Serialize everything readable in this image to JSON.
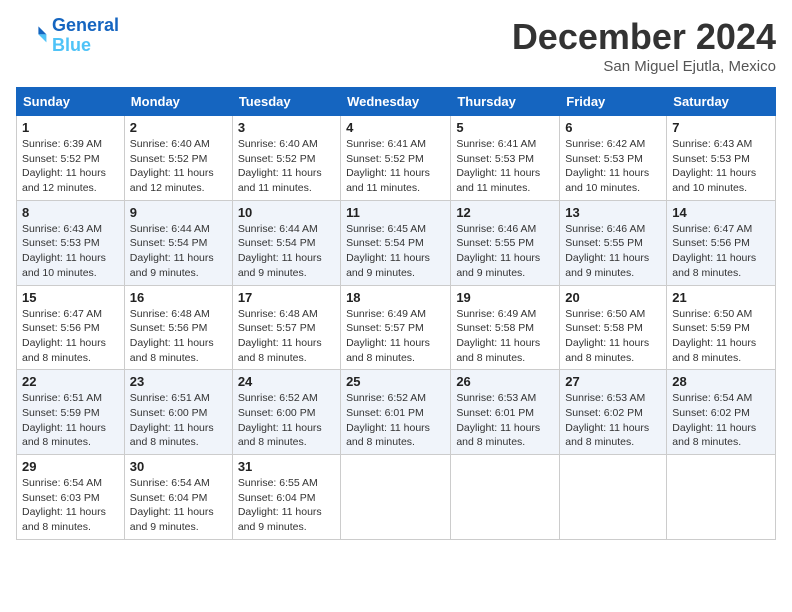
{
  "header": {
    "logo_line1": "General",
    "logo_line2": "Blue",
    "month": "December 2024",
    "location": "San Miguel Ejutla, Mexico"
  },
  "weekdays": [
    "Sunday",
    "Monday",
    "Tuesday",
    "Wednesday",
    "Thursday",
    "Friday",
    "Saturday"
  ],
  "weeks": [
    [
      {
        "day": "1",
        "info": "Sunrise: 6:39 AM\nSunset: 5:52 PM\nDaylight: 11 hours\nand 12 minutes."
      },
      {
        "day": "2",
        "info": "Sunrise: 6:40 AM\nSunset: 5:52 PM\nDaylight: 11 hours\nand 12 minutes."
      },
      {
        "day": "3",
        "info": "Sunrise: 6:40 AM\nSunset: 5:52 PM\nDaylight: 11 hours\nand 11 minutes."
      },
      {
        "day": "4",
        "info": "Sunrise: 6:41 AM\nSunset: 5:52 PM\nDaylight: 11 hours\nand 11 minutes."
      },
      {
        "day": "5",
        "info": "Sunrise: 6:41 AM\nSunset: 5:53 PM\nDaylight: 11 hours\nand 11 minutes."
      },
      {
        "day": "6",
        "info": "Sunrise: 6:42 AM\nSunset: 5:53 PM\nDaylight: 11 hours\nand 10 minutes."
      },
      {
        "day": "7",
        "info": "Sunrise: 6:43 AM\nSunset: 5:53 PM\nDaylight: 11 hours\nand 10 minutes."
      }
    ],
    [
      {
        "day": "8",
        "info": "Sunrise: 6:43 AM\nSunset: 5:53 PM\nDaylight: 11 hours\nand 10 minutes."
      },
      {
        "day": "9",
        "info": "Sunrise: 6:44 AM\nSunset: 5:54 PM\nDaylight: 11 hours\nand 9 minutes."
      },
      {
        "day": "10",
        "info": "Sunrise: 6:44 AM\nSunset: 5:54 PM\nDaylight: 11 hours\nand 9 minutes."
      },
      {
        "day": "11",
        "info": "Sunrise: 6:45 AM\nSunset: 5:54 PM\nDaylight: 11 hours\nand 9 minutes."
      },
      {
        "day": "12",
        "info": "Sunrise: 6:46 AM\nSunset: 5:55 PM\nDaylight: 11 hours\nand 9 minutes."
      },
      {
        "day": "13",
        "info": "Sunrise: 6:46 AM\nSunset: 5:55 PM\nDaylight: 11 hours\nand 9 minutes."
      },
      {
        "day": "14",
        "info": "Sunrise: 6:47 AM\nSunset: 5:56 PM\nDaylight: 11 hours\nand 8 minutes."
      }
    ],
    [
      {
        "day": "15",
        "info": "Sunrise: 6:47 AM\nSunset: 5:56 PM\nDaylight: 11 hours\nand 8 minutes."
      },
      {
        "day": "16",
        "info": "Sunrise: 6:48 AM\nSunset: 5:56 PM\nDaylight: 11 hours\nand 8 minutes."
      },
      {
        "day": "17",
        "info": "Sunrise: 6:48 AM\nSunset: 5:57 PM\nDaylight: 11 hours\nand 8 minutes."
      },
      {
        "day": "18",
        "info": "Sunrise: 6:49 AM\nSunset: 5:57 PM\nDaylight: 11 hours\nand 8 minutes."
      },
      {
        "day": "19",
        "info": "Sunrise: 6:49 AM\nSunset: 5:58 PM\nDaylight: 11 hours\nand 8 minutes."
      },
      {
        "day": "20",
        "info": "Sunrise: 6:50 AM\nSunset: 5:58 PM\nDaylight: 11 hours\nand 8 minutes."
      },
      {
        "day": "21",
        "info": "Sunrise: 6:50 AM\nSunset: 5:59 PM\nDaylight: 11 hours\nand 8 minutes."
      }
    ],
    [
      {
        "day": "22",
        "info": "Sunrise: 6:51 AM\nSunset: 5:59 PM\nDaylight: 11 hours\nand 8 minutes."
      },
      {
        "day": "23",
        "info": "Sunrise: 6:51 AM\nSunset: 6:00 PM\nDaylight: 11 hours\nand 8 minutes."
      },
      {
        "day": "24",
        "info": "Sunrise: 6:52 AM\nSunset: 6:00 PM\nDaylight: 11 hours\nand 8 minutes."
      },
      {
        "day": "25",
        "info": "Sunrise: 6:52 AM\nSunset: 6:01 PM\nDaylight: 11 hours\nand 8 minutes."
      },
      {
        "day": "26",
        "info": "Sunrise: 6:53 AM\nSunset: 6:01 PM\nDaylight: 11 hours\nand 8 minutes."
      },
      {
        "day": "27",
        "info": "Sunrise: 6:53 AM\nSunset: 6:02 PM\nDaylight: 11 hours\nand 8 minutes."
      },
      {
        "day": "28",
        "info": "Sunrise: 6:54 AM\nSunset: 6:02 PM\nDaylight: 11 hours\nand 8 minutes."
      }
    ],
    [
      {
        "day": "29",
        "info": "Sunrise: 6:54 AM\nSunset: 6:03 PM\nDaylight: 11 hours\nand 8 minutes."
      },
      {
        "day": "30",
        "info": "Sunrise: 6:54 AM\nSunset: 6:04 PM\nDaylight: 11 hours\nand 9 minutes."
      },
      {
        "day": "31",
        "info": "Sunrise: 6:55 AM\nSunset: 6:04 PM\nDaylight: 11 hours\nand 9 minutes."
      },
      {
        "day": "",
        "info": ""
      },
      {
        "day": "",
        "info": ""
      },
      {
        "day": "",
        "info": ""
      },
      {
        "day": "",
        "info": ""
      }
    ]
  ]
}
